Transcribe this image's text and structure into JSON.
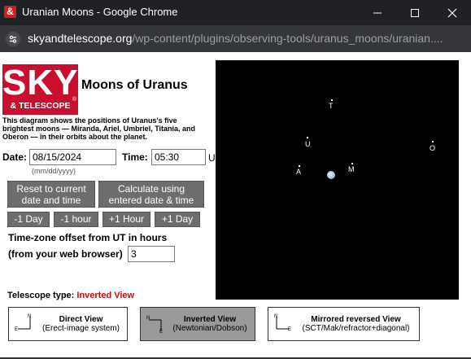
{
  "window": {
    "title": "Uranian Moons - Google Chrome",
    "url_domain": "skyandtelescope.org",
    "url_path": "/wp-content/plugins/observing-tools/uranus_moons/uranian...."
  },
  "logo": {
    "line1": "SKY",
    "line2": "& TELESCOPE",
    "reg": "®"
  },
  "page": {
    "title": "Moons of Uranus",
    "description": "This diagram shows the positions of Uranus's five brightest moons — Miranda, Ariel, Umbriel, Titania, and Oberon — in their orbits about the planet."
  },
  "form": {
    "date_label": "Date:",
    "date_value": "08/15/2024",
    "date_hint": "(mm/dd/yyyy)",
    "time_label": "Time:",
    "time_value": "05:30",
    "time_suffix": "U",
    "reset_line1": "Reset to current",
    "reset_line2": "date and time",
    "calc_line1": "Calculate using",
    "calc_line2": "entered date & time",
    "step_buttons": [
      "-1 Day",
      "-1 hour",
      "+1 Hour",
      "+1 Day"
    ],
    "tz_label_line1": "Time-zone offset from UT in hours",
    "tz_label_line2": "(from your web browser)",
    "tz_value": "3"
  },
  "telescope": {
    "label": "Telescope type:",
    "value": "Inverted View",
    "views": [
      {
        "name": "Direct View",
        "sub": "(Erect-image system)",
        "active": false
      },
      {
        "name": "Inverted View",
        "sub": "(Newtonian/Dobson)",
        "active": true
      },
      {
        "name": "Mirrored reversed View",
        "sub": "(SCT/Mak/refractor+diagonal)",
        "active": false
      }
    ],
    "orient_N": "N",
    "orient_E": "E"
  },
  "moons": [
    {
      "label": "T",
      "name": "Titania"
    },
    {
      "label": "U",
      "name": "Umbriel"
    },
    {
      "label": "O",
      "name": "Oberon"
    },
    {
      "label": "A",
      "name": "Ariel"
    },
    {
      "label": "M",
      "name": "Miranda"
    }
  ],
  "colors": {
    "logo_red": "#c8102e",
    "active_view": "#e00000",
    "button_gray": "#6d6d6d",
    "sky": "#000000"
  }
}
